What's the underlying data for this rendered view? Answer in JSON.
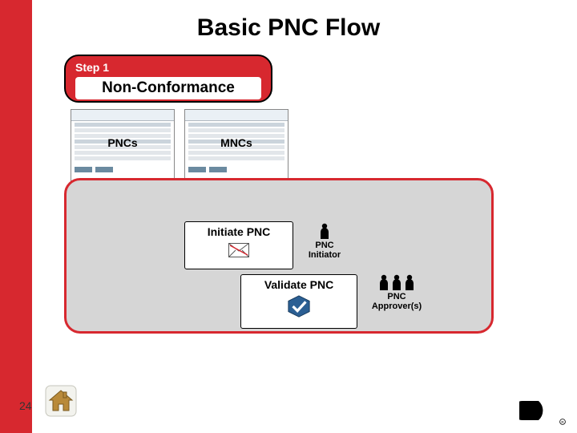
{
  "title": "Basic PNC Flow",
  "step": {
    "label": "Step 1",
    "title": "Non-Conformance"
  },
  "thumbs": {
    "left_caption": "PNCs",
    "right_caption": "MNCs"
  },
  "initiate": {
    "label": "Initiate PNC"
  },
  "validate": {
    "label": "Validate PNC"
  },
  "actors": {
    "initiator": "PNC\nInitiator",
    "approvers": "PNC\nApprover(s)"
  },
  "page_number": "24",
  "icons": {
    "home": "home-icon",
    "envelope": "envelope-icon",
    "check": "check-badge-icon",
    "person": "person-icon",
    "logo": "cummins-logo"
  },
  "colors": {
    "brand_red": "#d7282f",
    "panel_gray": "#d6d6d6"
  }
}
